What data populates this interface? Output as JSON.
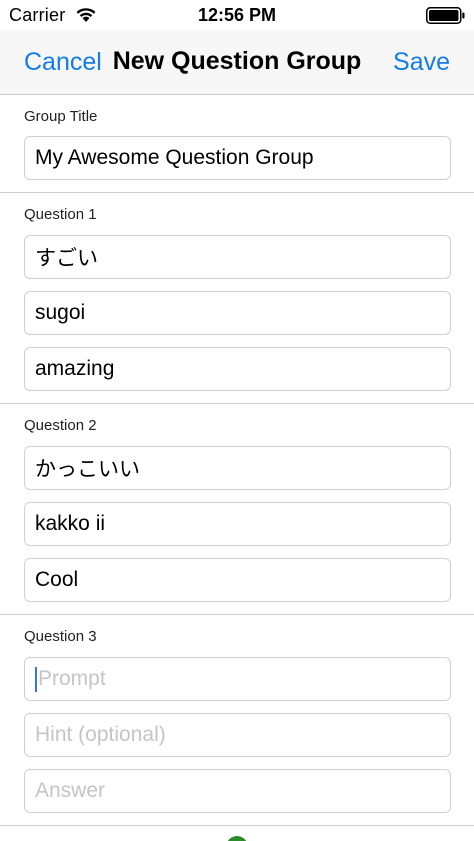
{
  "status_bar": {
    "carrier": "Carrier",
    "time": "12:56 PM",
    "wifi_icon": "wifi-icon",
    "battery_icon": "battery-icon"
  },
  "nav": {
    "cancel": "Cancel",
    "title": "New Question Group",
    "save": "Save"
  },
  "group": {
    "label": "Group Title",
    "value": "My Awesome Question Group"
  },
  "questions": [
    {
      "label": "Question 1",
      "prompt": "すごい",
      "hint": "sugoi",
      "answer": "amazing"
    },
    {
      "label": "Question 2",
      "prompt": "かっこいい",
      "hint": "kakko ii",
      "answer": "Cool"
    },
    {
      "label": "Question 3",
      "prompt_placeholder": "Prompt",
      "hint_placeholder": "Hint (optional)",
      "answer_placeholder": "Answer"
    }
  ],
  "colors": {
    "accent": "#127ce8",
    "caret": "#3f6ff0",
    "placeholder": "#c4c4c9",
    "border": "#cfcfd2"
  }
}
